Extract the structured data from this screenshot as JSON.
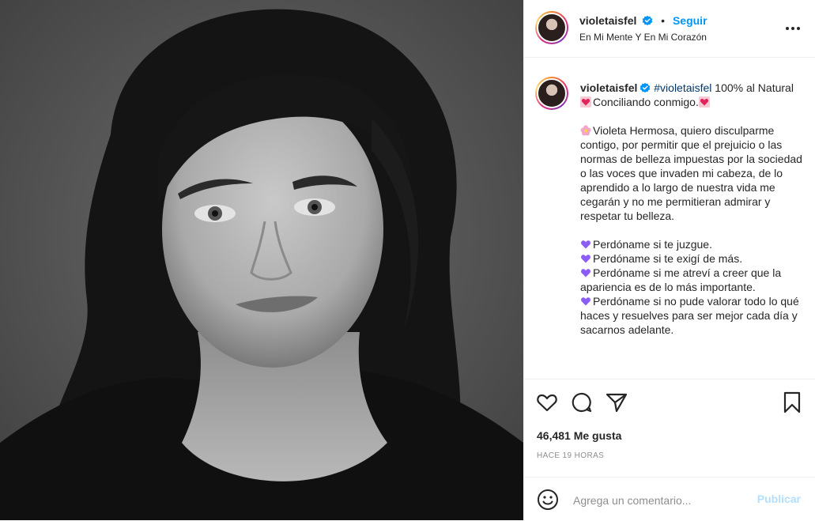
{
  "post": {
    "username": "violetaisfel",
    "follow_label": "Seguir",
    "separator": "•",
    "location": "En Mi Mente Y En Mi Corazón",
    "more_icon": "more-options-icon"
  },
  "caption": {
    "username": "violetaisfel",
    "hashtag": "#violetaisfel",
    "line1_rest": " 100% al Natural",
    "line2": "Conciliando conmigo.",
    "para1": "Violeta Hermosa, quiero disculparme contigo, por permitir que el prejuicio o las normas de belleza impuestas por la sociedad o las voces que invaden mi cabeza, de lo aprendido a lo largo de nuestra vida me cegarán y no me permitieran admirar y respetar tu belleza.",
    "items": [
      "Perdóname si te juzgue.",
      "Perdóname si te exigí de más.",
      "Perdóname si me atreví a creer que la apariencia es de lo más importante.",
      "Perdóname si no pude valorar todo lo qué haces y resuelves para ser mejor cada día y sacarnos adelante."
    ]
  },
  "stats": {
    "likes": "46,481 Me gusta",
    "time": "HACE 19 HORAS"
  },
  "comment": {
    "placeholder": "Agrega un comentario...",
    "publish_label": "Publicar"
  },
  "colors": {
    "accent": "#0095f6",
    "publish_disabled": "#b2dffc",
    "hashtag": "#00376b",
    "heart_emoji": "#e0245e",
    "purple_heart": "#8b5cf6",
    "blossom": "#f4a6c8"
  }
}
